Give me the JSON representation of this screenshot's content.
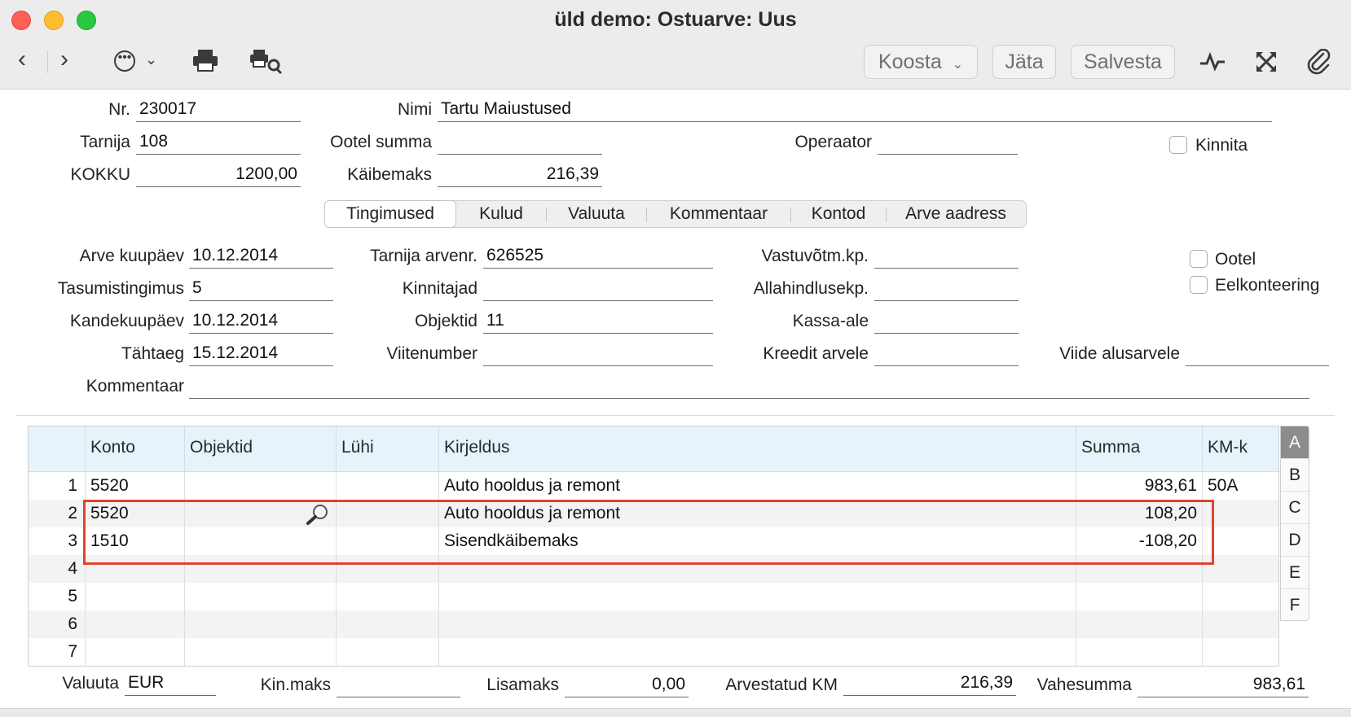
{
  "window": {
    "title": "üld demo: Ostuarve: Uus"
  },
  "toolbar": {
    "koosta": "Koosta",
    "jata": "Jäta",
    "salvesta": "Salvesta"
  },
  "header": {
    "nr_label": "Nr.",
    "nr_value": "230017",
    "nimi_label": "Nimi",
    "nimi_value": "Tartu Maiustused",
    "tarnija_label": "Tarnija",
    "tarnija_value": "108",
    "ootel_summa_label": "Ootel summa",
    "ootel_summa_value": "",
    "operaator_label": "Operaator",
    "operaator_value": "",
    "kinnita_label": "Kinnita",
    "kokku_label": "KOKKU",
    "kokku_value": "1200,00",
    "kaibemaks_label": "Käibemaks",
    "kaibemaks_value": "216,39"
  },
  "tabs": [
    {
      "label": "Tingimused"
    },
    {
      "label": "Kulud"
    },
    {
      "label": "Valuuta"
    },
    {
      "label": "Kommentaar"
    },
    {
      "label": "Kontod"
    },
    {
      "label": "Arve aadress"
    }
  ],
  "terms": {
    "arve_kuupaev_label": "Arve kuupäev",
    "arve_kuupaev_value": "10.12.2014",
    "tarnija_arvenr_label": "Tarnija arvenr.",
    "tarnija_arvenr_value": "626525",
    "vastuvotm_label": "Vastuvõtm.kp.",
    "vastuvotm_value": "",
    "ootel_label": "Ootel",
    "tasumistingimus_label": "Tasumistingimus",
    "tasumistingimus_value": "5",
    "kinnitajad_label": "Kinnitajad",
    "kinnitajad_value": "",
    "allahindlus_label": "Allahindlusekp.",
    "allahindlus_value": "",
    "eelkonteering_label": "Eelkonteering",
    "kandekuupaev_label": "Kandekuupäev",
    "kandekuupaev_value": "10.12.2014",
    "objektid_label": "Objektid",
    "objektid_value": "11",
    "kassa_ale_label": "Kassa-ale",
    "kassa_ale_value": "",
    "tahtaeg_label": "Tähtaeg",
    "tahtaeg_value": "15.12.2014",
    "viitenumber_label": "Viitenumber",
    "viitenumber_value": "",
    "kreedit_label": "Kreedit arvele",
    "kreedit_value": "",
    "viide_label": "Viide alusarvele",
    "viide_value": "",
    "kommentaar_label": "Kommentaar",
    "kommentaar_value": ""
  },
  "grid": {
    "columns": [
      "Konto",
      "Objektid",
      "Lühi",
      "Kirjeldus",
      "Summa",
      "KM-k"
    ],
    "rows": [
      {
        "n": "1",
        "konto": "5520",
        "objektid": "",
        "luhi": "",
        "kirjeldus": "Auto hooldus ja remont",
        "summa": "983,61",
        "kmk": "50A"
      },
      {
        "n": "2",
        "konto": "5520",
        "objektid": "",
        "luhi": "",
        "kirjeldus": "Auto hooldus ja remont",
        "summa": "108,20",
        "kmk": ""
      },
      {
        "n": "3",
        "konto": "1510",
        "objektid": "",
        "luhi": "",
        "kirjeldus": "Sisendkäibemaks",
        "summa": "-108,20",
        "kmk": ""
      },
      {
        "n": "4",
        "konto": "",
        "objektid": "",
        "luhi": "",
        "kirjeldus": "",
        "summa": "",
        "kmk": ""
      },
      {
        "n": "5",
        "konto": "",
        "objektid": "",
        "luhi": "",
        "kirjeldus": "",
        "summa": "",
        "kmk": ""
      },
      {
        "n": "6",
        "konto": "",
        "objektid": "",
        "luhi": "",
        "kirjeldus": "",
        "summa": "",
        "kmk": ""
      },
      {
        "n": "7",
        "konto": "",
        "objektid": "",
        "luhi": "",
        "kirjeldus": "",
        "summa": "",
        "kmk": ""
      }
    ],
    "side_letters": [
      "A",
      "B",
      "C",
      "D",
      "E",
      "F"
    ]
  },
  "footer": {
    "valuuta_label": "Valuuta",
    "valuuta_value": "EUR",
    "kinmaks_label": "Kin.maks",
    "kinmaks_value": "",
    "lisamaks_label": "Lisamaks",
    "lisamaks_value": "0,00",
    "arvestatud_km_label": "Arvestatud KM",
    "arvestatud_km_value": "216,39",
    "vahesumma_label": "Vahesumma",
    "vahesumma_value": "983,61"
  },
  "colors": {
    "highlight": "#e2432c",
    "grid_header": "#e6f3fb"
  }
}
